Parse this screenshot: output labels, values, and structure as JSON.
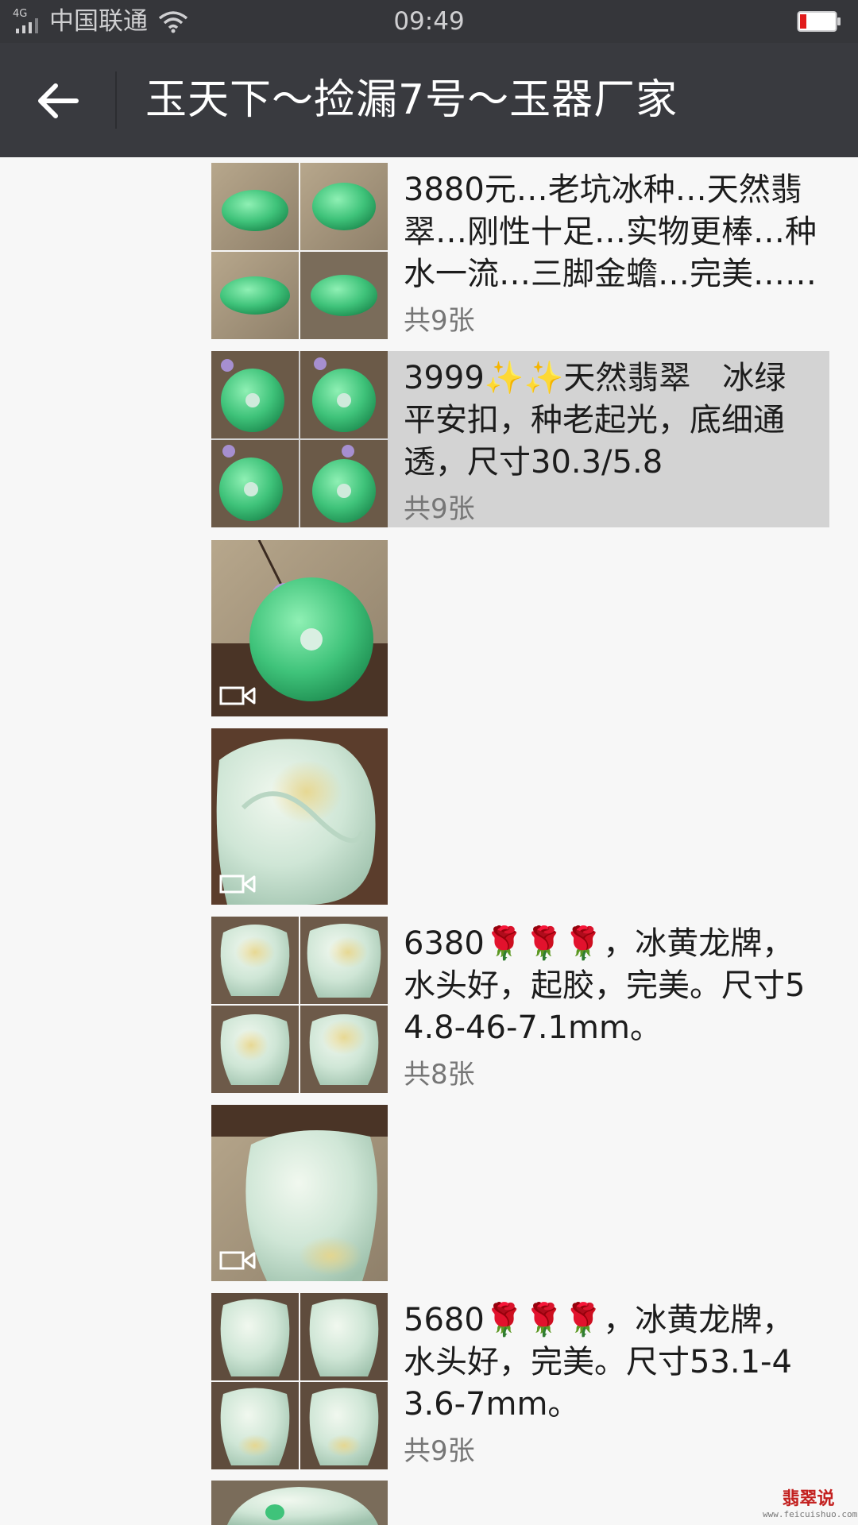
{
  "status_bar": {
    "network": "4G",
    "carrier": "中国联通",
    "time": "09:49",
    "icons": [
      "signal-icon",
      "wifi-icon",
      "battery-low-icon"
    ],
    "battery_color": "#e11b1b"
  },
  "header": {
    "title": "玉天下～捡漏7号～玉器厂家",
    "back_icon": "back-arrow-icon"
  },
  "posts": [
    {
      "text": "3880元…老坑冰种…天然翡翠…刚性十足…实物更棒…种水一流…三脚金蟾…完美……",
      "count": "共9张",
      "media": "grid",
      "highlighted": false
    },
    {
      "text": "3999✨✨天然翡翠　冰绿平安扣，种老起光，底细通透，尺寸30.3/5.8",
      "count": "共9张",
      "media": "grid",
      "highlighted": true
    },
    {
      "text": "",
      "count": "",
      "media": "video",
      "highlighted": false
    },
    {
      "text": "",
      "count": "",
      "media": "video",
      "highlighted": false
    },
    {
      "text": "6380🌹🌹🌹，冰黄龙牌，水头好，起胶，完美。尺寸54.8-46-7.1mm。",
      "count": "共8张",
      "media": "grid",
      "highlighted": false
    },
    {
      "text": "",
      "count": "",
      "media": "video",
      "highlighted": false
    },
    {
      "text": "5680🌹🌹🌹，冰黄龙牌，水头好，完美。尺寸53.1-43.6-7mm。",
      "count": "共9张",
      "media": "grid",
      "highlighted": false
    }
  ],
  "watermark": {
    "name": "翡翠说",
    "url": "www.feicuishuo.com"
  },
  "colors": {
    "status_bar_bg": "#35363a",
    "title_bar_bg": "#393a3f",
    "page_bg": "#f7f7f7",
    "highlight_bg": "#d3d3d3",
    "count_text": "#767676",
    "jade_green": "#3fc37a",
    "ice_jade": "#cfe6d6"
  }
}
